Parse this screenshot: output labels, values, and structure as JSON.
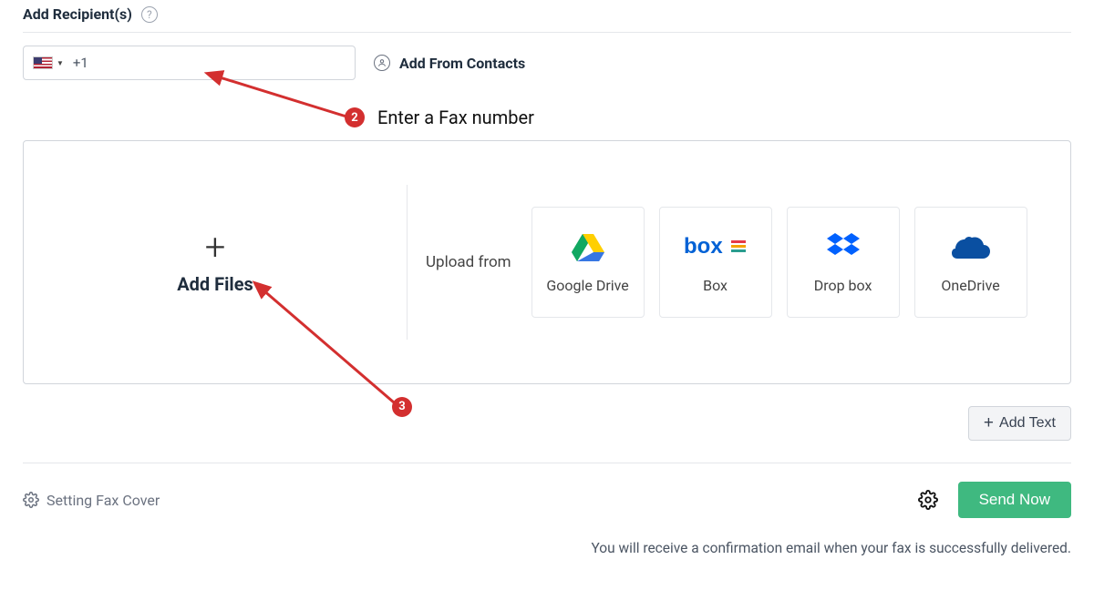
{
  "header": {
    "title": "Add Recipient(s)"
  },
  "recipient": {
    "country_prefix": "+1",
    "add_from_contacts": "Add From Contacts"
  },
  "annotations": {
    "step2_badge": "2",
    "step2_label": "Enter a Fax number",
    "step3_badge": "3"
  },
  "upload": {
    "add_files": "Add Files",
    "upload_from": "Upload from",
    "providers": [
      {
        "name": "Google Drive"
      },
      {
        "name": "Box"
      },
      {
        "name": "Drop box"
      },
      {
        "name": "OneDrive"
      }
    ]
  },
  "actions": {
    "add_text": "Add Text",
    "setting_fax_cover": "Setting Fax Cover",
    "send_now": "Send Now"
  },
  "footer": {
    "confirmation": "You will receive a confirmation email when your fax is successfully delivered."
  }
}
